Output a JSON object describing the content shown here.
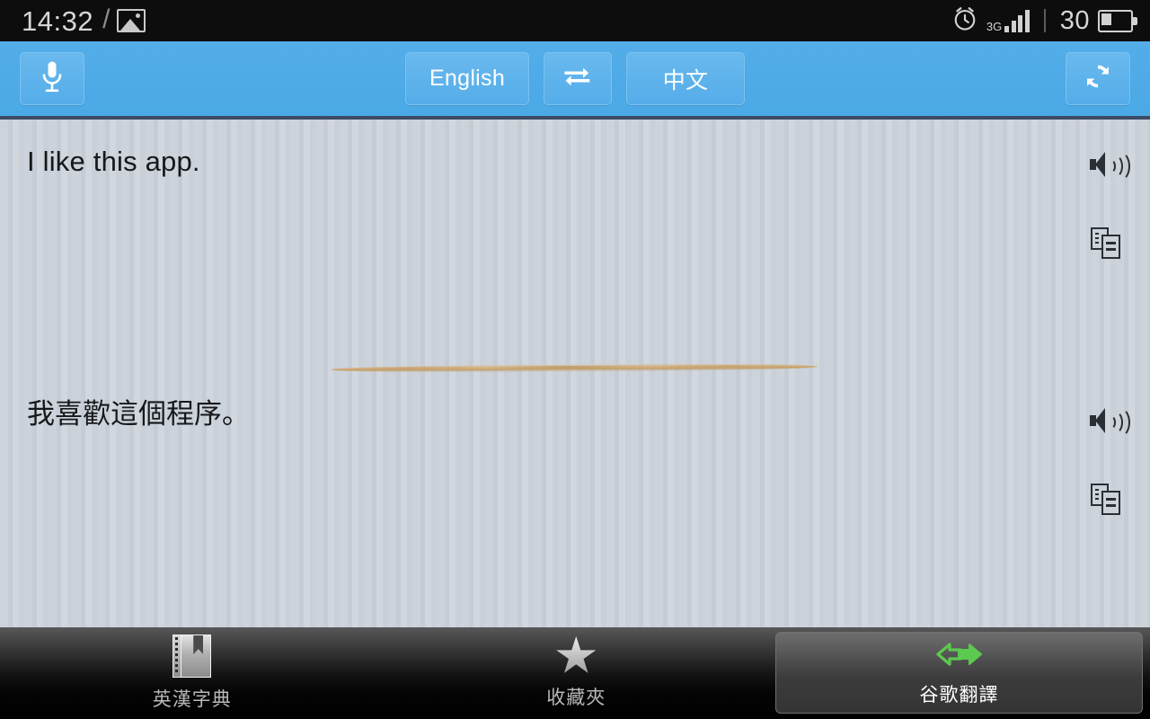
{
  "statusbar": {
    "clock": "14:32",
    "separator": "/",
    "image_icon": "image-icon",
    "alarm_icon": "alarm-clock-icon",
    "network_type": "3G",
    "signal_icon": "signal-bars-icon",
    "battery_percent": "30",
    "battery_icon": "battery-icon"
  },
  "toolbar": {
    "mic_icon": "microphone-icon",
    "mic_label": "Voice input",
    "source_language": "English",
    "swap_icon": "swap-languages-icon",
    "target_language": "中文",
    "refresh_icon": "refresh-icon",
    "background_color": "#4fabe8"
  },
  "content": {
    "source_text": "I like this app.",
    "target_text": "我喜歡這個程序。",
    "divider": "brush-stroke-divider",
    "source_actions": {
      "speak_icon": "speaker-icon",
      "copy_icon": "copy-icon"
    },
    "target_actions": {
      "speak_icon": "speaker-icon",
      "copy_icon": "copy-icon"
    }
  },
  "bottom_nav": {
    "tabs": [
      {
        "label": "英漢字典",
        "icon": "dictionary-book-icon",
        "active": false
      },
      {
        "label": "收藏夾",
        "icon": "star-icon",
        "active": false
      },
      {
        "label": "谷歌翻譯",
        "icon": "translate-arrows-icon",
        "active": true
      }
    ],
    "accent_color": "#5cc94f"
  }
}
